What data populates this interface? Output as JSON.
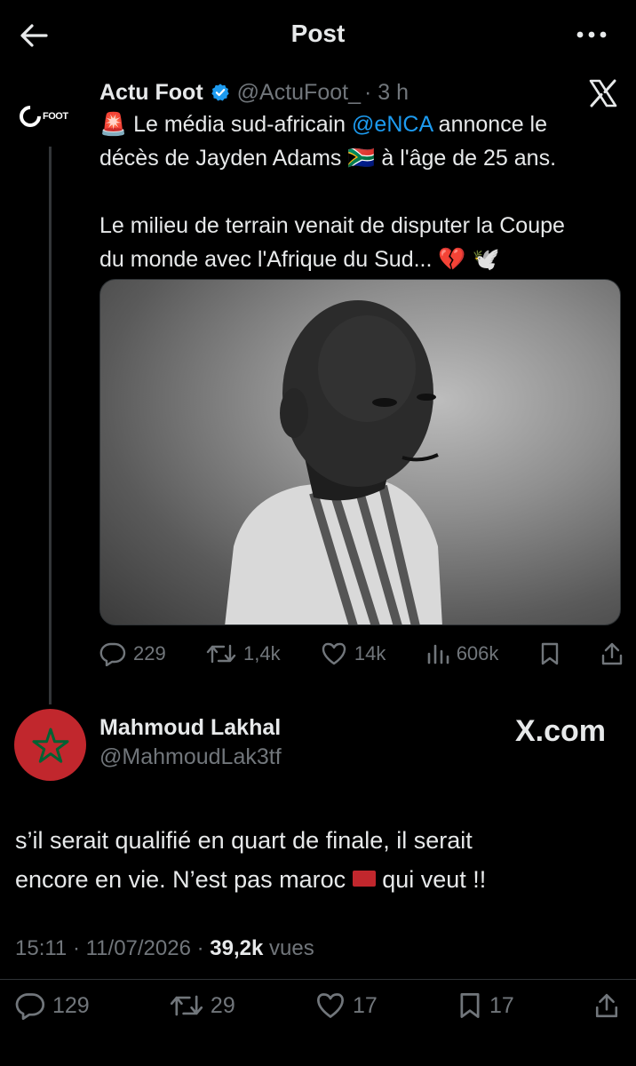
{
  "header": {
    "title": "Post"
  },
  "quoted_post": {
    "author_name": "Actu Foot",
    "author_handle": "@ActuFoot_",
    "time": "· 3 h",
    "avatar_text": "FOOT",
    "text_line1_pre": "🚨 Le média sud-africain ",
    "mention": "@eNCA",
    "text_line1_post": " annonce le",
    "text_line2": "décès de Jayden Adams 🇿🇦 à l'âge de 25 ans.",
    "text_line3": "Le milieu de terrain venait de disputer la Coupe",
    "text_line4": "du monde avec l'Afrique du Sud... 💔 🕊️",
    "stats": {
      "replies": "229",
      "reposts": "1,4k",
      "likes": "14k",
      "views": "606k"
    }
  },
  "main_post": {
    "author_name": "Mahmoud Lakhal",
    "author_handle": "@MahmoudLak3tf",
    "source_logo": "X.com",
    "text_line1": "s’il serait qualifié en quart de finale, il serait",
    "text_line2_pre": "encore en vie. N’est pas maroc ",
    "text_line2_post": " qui veut !!",
    "timestamp": "15:11 · 11/07/2026 · ",
    "views_count": "39,2k",
    "views_label": "vues",
    "stats": {
      "replies": "129",
      "reposts": "29",
      "likes": "17",
      "bookmarks": "17"
    }
  },
  "colors": {
    "background": "#000000",
    "accent": "#1d9bf0",
    "muted": "#71767b",
    "text": "#e7e9ea",
    "morocco_red": "#c1272d",
    "morocco_green": "#006233"
  },
  "icons": [
    "back-arrow-icon",
    "more-icon",
    "verified-badge-icon",
    "x-logo-icon",
    "reply-icon",
    "repost-icon",
    "like-icon",
    "views-icon",
    "bookmark-icon",
    "share-icon",
    "morocco-flag-icon"
  ]
}
